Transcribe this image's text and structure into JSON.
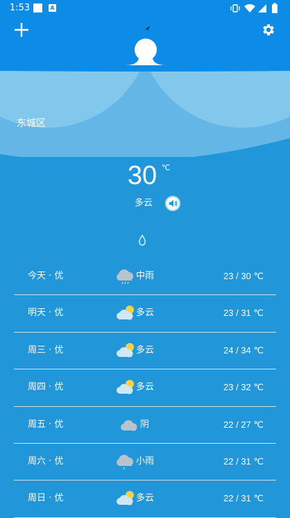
{
  "status_bar": {
    "time": "1:53"
  },
  "weather": {
    "district": "东城区",
    "temperature": "30",
    "unit": "℃",
    "condition": "多云"
  },
  "forecast": [
    {
      "day": "今天 · 优",
      "icon": "rain-cloud-icon",
      "condition": "中雨",
      "range": "23 / 30 ℃"
    },
    {
      "day": "明天 · 优",
      "icon": "partly-cloudy-icon",
      "condition": "多云",
      "range": "23 / 31 ℃"
    },
    {
      "day": "周三 · 优",
      "icon": "partly-cloudy-icon",
      "condition": "多云",
      "range": "24 / 34 ℃"
    },
    {
      "day": "周四 · 优",
      "icon": "partly-cloudy-icon",
      "condition": "多云",
      "range": "23 / 32 ℃"
    },
    {
      "day": "周五 · 优",
      "icon": "overcast-cloud-icon",
      "condition": "阴",
      "range": "22 / 27 ℃"
    },
    {
      "day": "周六 · 优",
      "icon": "light-rain-cloud-icon",
      "condition": "小雨",
      "range": "22 / 31 ℃"
    },
    {
      "day": "周日 · 优",
      "icon": "partly-cloudy-icon",
      "condition": "多云",
      "range": "22 / 31 ℃"
    }
  ],
  "colors": {
    "header": "#0c8ce6",
    "background": "#2196d8",
    "sun": "#f5d04a",
    "cloud": "#cfe8f7",
    "grey_cloud": "#b9c3cc"
  }
}
